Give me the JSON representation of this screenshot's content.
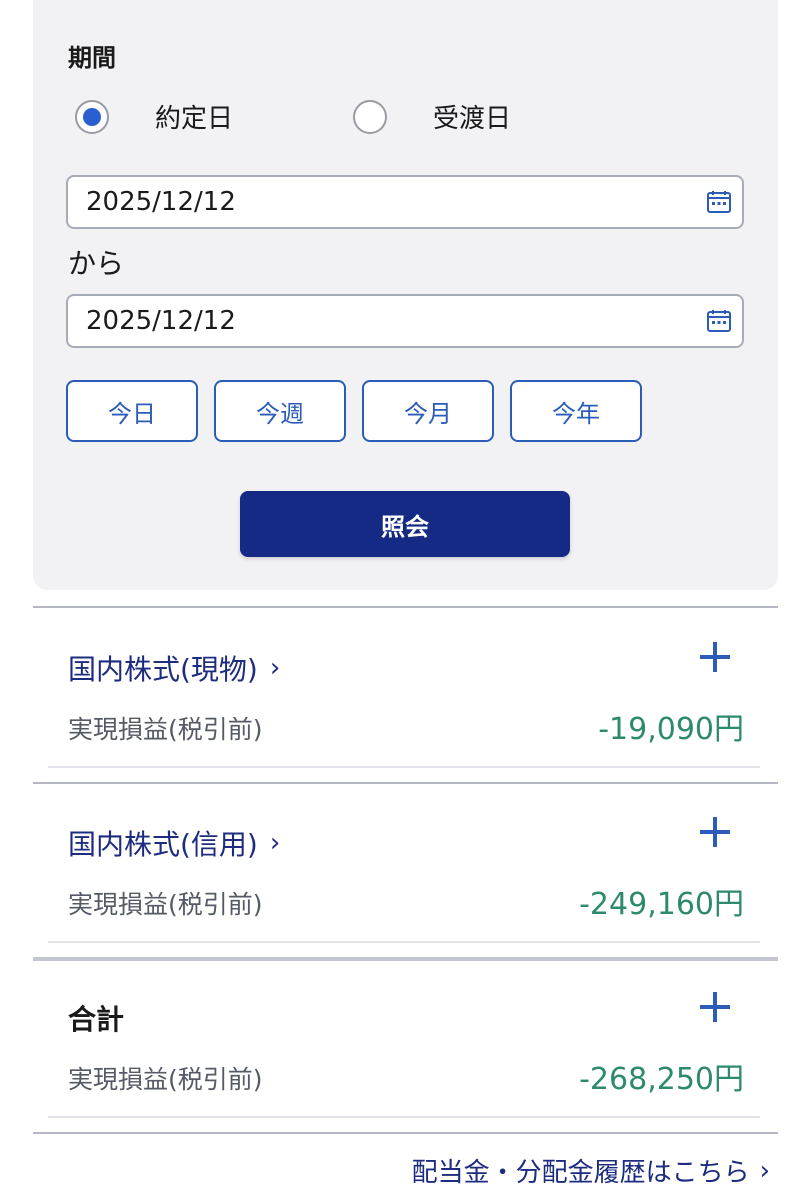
{
  "filter": {
    "title": "期間",
    "date_basis": {
      "options": [
        "約定日",
        "受渡日"
      ],
      "selected": "約定日"
    },
    "from_date": "2025/12/12",
    "to_label": "から",
    "to_date": "2025/12/12",
    "quick_ranges": [
      "今日",
      "今週",
      "今月",
      "今年"
    ],
    "query_button": "照会"
  },
  "sections": [
    {
      "title": "国内株式(現物)",
      "chevron": "›",
      "expand_icon": "plus-icon",
      "metric_label": "実現損益(税引前)",
      "metric_value": "-19,090円"
    },
    {
      "title": "国内株式(信用)",
      "chevron": "›",
      "expand_icon": "plus-icon",
      "metric_label": "実現損益(税引前)",
      "metric_value": "-249,160円"
    }
  ],
  "total": {
    "title": "合計",
    "expand_icon": "plus-icon",
    "metric_label": "実現損益(税引前)",
    "metric_value": "-268,250円"
  },
  "footer_link": {
    "label": "配当金・分配金履歴はこちら",
    "chevron": "›"
  },
  "colors": {
    "accent": "#2b5cb8",
    "navy": "#152a85",
    "positive_green": "#2e8a6e",
    "radio_selected": "#2a5fd0"
  }
}
